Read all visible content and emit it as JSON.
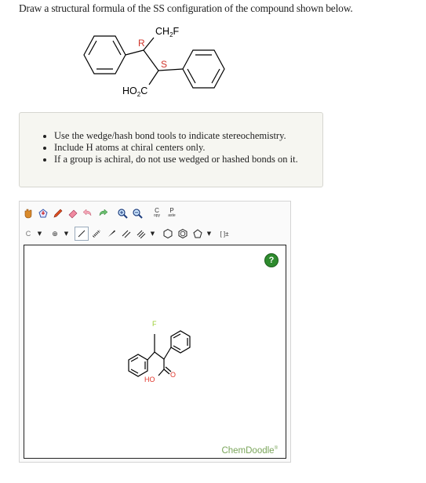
{
  "question": {
    "text": "Draw a structural formula of the SS configuration of the compound shown below."
  },
  "structure": {
    "label_r": "R",
    "label_s": "S",
    "label_ch2f": "CH",
    "label_ch2f_sub": "2",
    "label_ch2f_tail": "F",
    "label_ho2c": "HO",
    "label_ho2c_sub": "2",
    "label_ho2c_tail": "C"
  },
  "instructions": {
    "items": [
      "Use the wedge/hash bond tools to indicate stereochemistry.",
      "Include H atoms at chiral centers only.",
      "If a group is achiral, do not use wedged or hashed bonds on it."
    ]
  },
  "editor": {
    "toolbar_top": [
      "hand-tool",
      "template-tool",
      "eraser-tool",
      "undo",
      "redo",
      "zoom-in",
      "zoom-out"
    ],
    "copy_label_top": "C",
    "copy_label_bottom": "opy",
    "paste_label_top": "P",
    "paste_label_bottom": "aste",
    "element_label": "C",
    "charge_label": "⊕",
    "bracket_label": "[ ]±",
    "canvas_labels": {
      "fluorine": "F",
      "hydroxyl": "HO",
      "oxygen": "O"
    },
    "help_label": "?",
    "brand": "ChemDoodle",
    "brand_mark": "®",
    "colors": {
      "fluorine": "#9acd32",
      "oxygen": "#e0342a",
      "help": "#2e8b2e",
      "brand": "#7aa55a"
    }
  }
}
